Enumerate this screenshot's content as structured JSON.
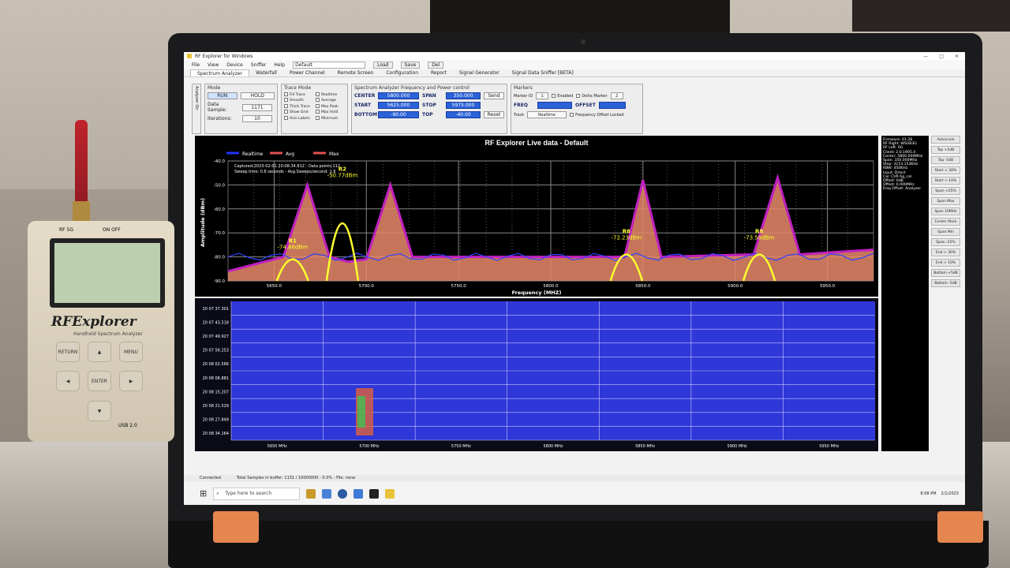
{
  "app": {
    "title": "RF Explorer for Windows",
    "menus": [
      "File",
      "View",
      "Device",
      "Sniffer",
      "Help"
    ],
    "preset": "Default",
    "buttons": [
      "Load",
      "Save",
      "Del"
    ],
    "tabs": [
      "Spectrum Analyzer",
      "Waterfall",
      "Power Channel",
      "Remote Screen",
      "Configuration",
      "Report",
      "Signal Generator",
      "Signal Data Sniffer [BETA]"
    ]
  },
  "controls": {
    "analyzer_label": "Analyzer On",
    "mode": {
      "title": "Mode",
      "run": "RUN",
      "hold": "HOLD",
      "data_sample_label": "Data Sample:",
      "data_sample": "1171",
      "iterations_label": "Iterations:",
      "iterations": "10"
    },
    "trace": {
      "title": "Trace Mode",
      "left": [
        "Fill Trace",
        "Smooth",
        "Thick Trace",
        "Show Grid",
        "Axis Labels"
      ],
      "right": [
        "Realtime",
        "Average",
        "Max Peak",
        "Max Hold",
        "Minimum"
      ]
    },
    "freq": {
      "title": "Spectrum Analyzer Frequency and Power control",
      "center_label": "CENTER",
      "center": "5800.000",
      "span_label": "SPAN",
      "span": "350.000",
      "start_label": "START",
      "start": "5625.000",
      "stop_label": "STOP",
      "stop": "5975.000",
      "bottom_label": "BOTTOM",
      "bottom": "-90.00",
      "top_label": "TOP",
      "top": "-40.00",
      "send": "Send",
      "reset": "Reset"
    },
    "markers": {
      "title": "Markers",
      "marker_id_label": "Marker ID",
      "marker_id": "1",
      "enabled": "Enabled",
      "delta": "Delta Marker",
      "delta_id": "2",
      "freq_label": "FREQ",
      "offset_label": "OFFSET",
      "track_label": "Track",
      "track": "Realtime",
      "freq_offset_locked": "Frequency Offset Locked"
    }
  },
  "graph": {
    "title": "RF Explorer Live data - Default",
    "legend": [
      "Realtime",
      "Avg",
      "Max"
    ],
    "captured": "Captured:2023-02-01 20:08:34.812 - Data points:112",
    "sweep": "Sweep time: 0.6 seconds - Avg.Sweeps/second: 1.6",
    "ylabel": "Amplitude (dBm)",
    "xlabel": "Frequency (MHZ)",
    "yticks": [
      "-40.0",
      "-50.0",
      "-60.0",
      "-70.0",
      "-80.0",
      "-90.0"
    ],
    "xticks": [
      "5650.0",
      "5700.0",
      "5750.0",
      "5800.0",
      "5850.0",
      "5900.0",
      "5950.0"
    ],
    "markers": [
      {
        "name": "R1",
        "value": "-74.88dBm"
      },
      {
        "name": "R2",
        "value": "-50.77dBm"
      },
      {
        "name": "R6",
        "value": "-72.23dBm"
      },
      {
        "name": "R8",
        "value": "-73.58dBm"
      }
    ]
  },
  "chart_data": {
    "type": "line",
    "title": "RF Explorer Live data - Default",
    "xlabel": "Frequency (MHZ)",
    "ylabel": "Amplitude (dBm)",
    "xlim": [
      5625,
      5975
    ],
    "ylim": [
      -90,
      -40
    ],
    "series": [
      {
        "name": "Max",
        "x": [
          5625,
          5655,
          5668,
          5680,
          5690,
          5700,
          5713,
          5725,
          5800,
          5840,
          5850,
          5860,
          5910,
          5923,
          5935,
          5975
        ],
        "values": [
          -86,
          -80,
          -50,
          -80,
          -82,
          -81,
          -50,
          -80,
          -80,
          -80,
          -48,
          -80,
          -79,
          -47,
          -79,
          -77
        ]
      }
    ],
    "grid": true,
    "legend_position": "top-left"
  },
  "waterfall": {
    "times": [
      "20 07 37.301",
      "20 07 43.518",
      "20 07 49.927",
      "20 07 56.253",
      "20 08 02.566",
      "20 08 08.881",
      "20 08 15.207",
      "20 08 21.529",
      "20 08 27.849",
      "20 08 34.164"
    ],
    "xticks": [
      "5650 MHz",
      "5700 MHz",
      "5750 MHz",
      "5800 MHz",
      "5850 MHz",
      "5900 MHz",
      "5950 MHz"
    ]
  },
  "info": [
    "Firmware: 01.28",
    "RF Right: WSUB3G",
    "RF Left: 6G",
    "Client: 2.0.1905.4",
    "Center: 5800.000MHz",
    "Span: 350.000MHz",
    "Step: 3153.153KHz",
    "RBW: 450KHz",
    "Input: Direct",
    "Cal: CVR 6g_cal",
    "Offset: 0dB",
    "Offset: 0.000MHz",
    "Freq Offset: Analyzer"
  ],
  "side_buttons": [
    "Autoscale",
    "Top +5dB",
    "Top -5dB",
    "Start < 30%",
    "Start < 10%",
    "Span +25%",
    "Span Max",
    "Span 10MHz",
    "Center Mark",
    "Span Min",
    "Span -25%",
    "End > 30%",
    "End > 10%",
    "Bottom +5dB",
    "Bottom -5dB"
  ],
  "status": {
    "connected": "Connected",
    "samples": "Total Samples in buffer: 1131 / 10000000 - 0.0% - File: none"
  },
  "taskbar": {
    "search": "Type here to search",
    "time": "8:08 PM",
    "date": "2/1/2023"
  },
  "device": {
    "brand": "RFExplorer",
    "subtitle": "Handheld Spectrum Analyzer",
    "model": "RF 5G",
    "onoff": "ON OFF",
    "return": "RETURN",
    "menu": "MENU",
    "enter": "ENTER",
    "usb": "USB 2.0"
  }
}
